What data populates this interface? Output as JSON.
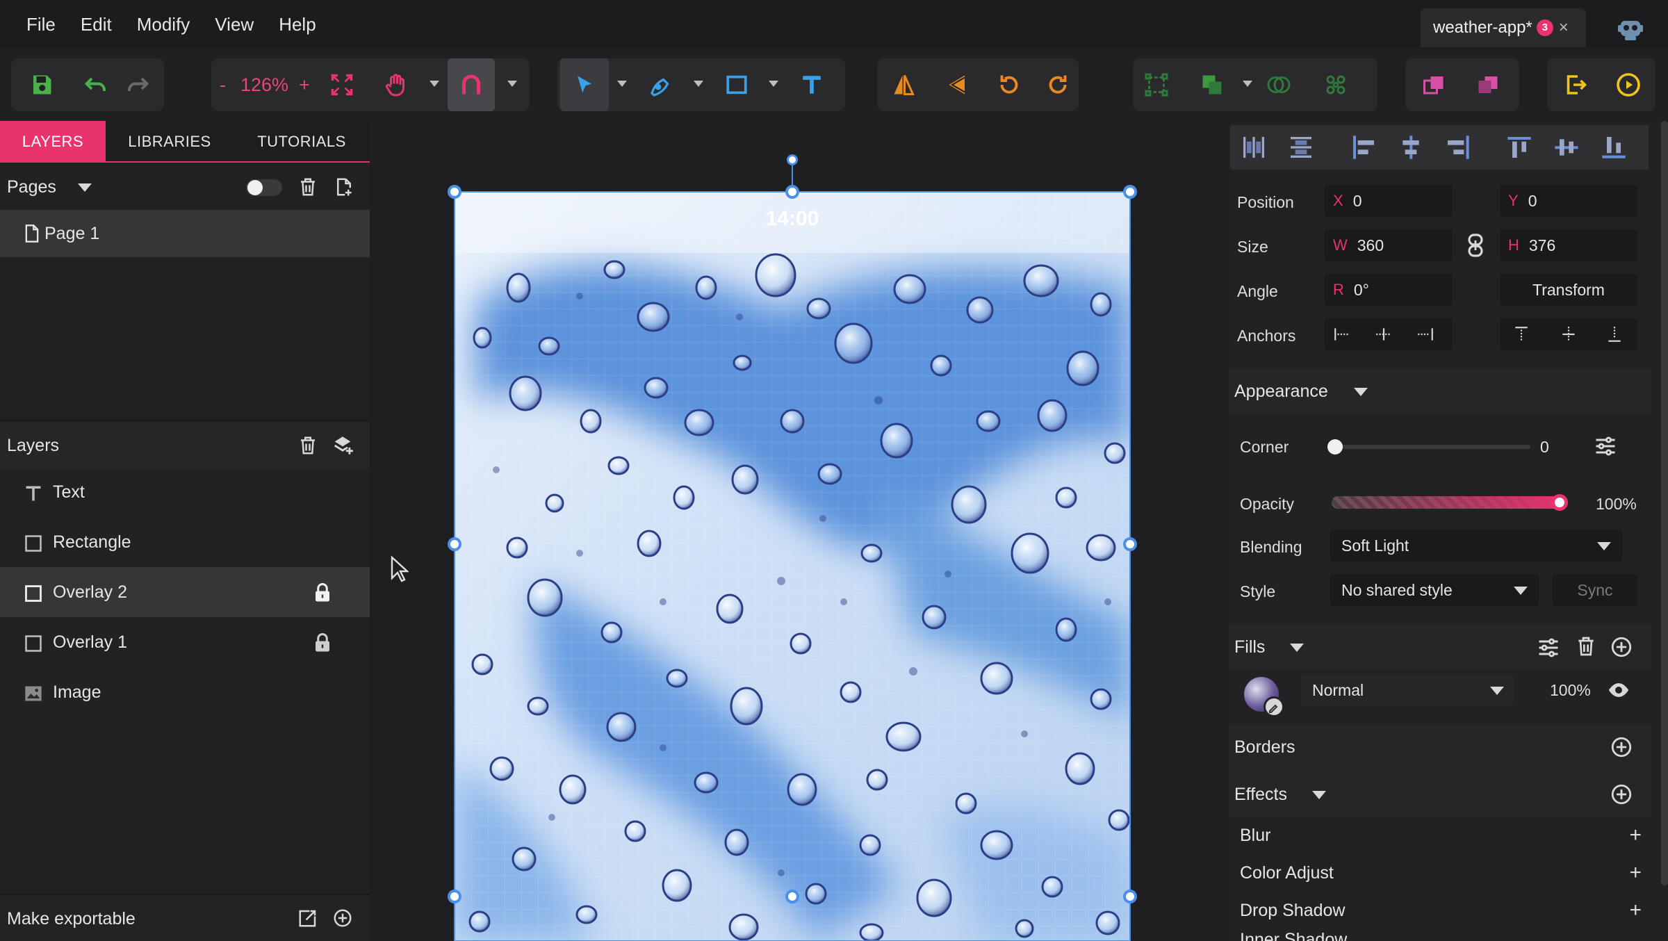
{
  "menu": {
    "file": "File",
    "edit": "Edit",
    "modify": "Modify",
    "view": "View",
    "help": "Help"
  },
  "document_tab": {
    "title": "weather-app*",
    "badge": "3",
    "close": "×"
  },
  "toolbar": {
    "zoom_minus": "-",
    "zoom_value": "126%",
    "zoom_plus": "+"
  },
  "left_panel": {
    "tabs": {
      "layers": "LAYERS",
      "libraries": "LIBRARIES",
      "tutorials": "TUTORIALS"
    },
    "pages_title": "Pages",
    "pages": [
      {
        "label": "Page 1"
      }
    ],
    "layers_title": "Layers",
    "layers": [
      {
        "label": "Text",
        "icon": "text-icon",
        "locked": false
      },
      {
        "label": "Rectangle",
        "icon": "rectangle-icon",
        "locked": false
      },
      {
        "label": "Overlay 2",
        "icon": "rectangle-icon",
        "locked": true
      },
      {
        "label": "Overlay 1",
        "icon": "rectangle-icon",
        "locked": true
      },
      {
        "label": "Image",
        "icon": "image-icon",
        "locked": false
      }
    ],
    "make_exportable": "Make exportable"
  },
  "canvas": {
    "status_time": "14:00"
  },
  "right_panel": {
    "position_label": "Position",
    "x_key": "X",
    "x_value": "0",
    "y_key": "Y",
    "y_value": "0",
    "size_label": "Size",
    "w_key": "W",
    "w_value": "360",
    "h_key": "H",
    "h_value": "376",
    "angle_label": "Angle",
    "r_key": "R",
    "r_value": "0°",
    "transform_button": "Transform",
    "anchors_label": "Anchors",
    "appearance_title": "Appearance",
    "corner_label": "Corner",
    "corner_value": "0",
    "corner_fraction": 0,
    "opacity_label": "Opacity",
    "opacity_value": "100%",
    "opacity_fraction": 1.0,
    "blending_label": "Blending",
    "blending_value": "Soft Light",
    "style_label": "Style",
    "style_value": "No shared style",
    "sync_button": "Sync",
    "fills_title": "Fills",
    "fill_blend": "Normal",
    "fill_opacity": "100%",
    "borders_title": "Borders",
    "effects_title": "Effects",
    "effects": [
      {
        "label": "Blur"
      },
      {
        "label": "Color Adjust"
      },
      {
        "label": "Drop Shadow"
      },
      {
        "label": "Inner Shadow"
      }
    ]
  },
  "colors": {
    "accent": "#e8336d",
    "selection": "#4a8fe8",
    "panel": "#222225",
    "canvas": "#1f1f21"
  }
}
